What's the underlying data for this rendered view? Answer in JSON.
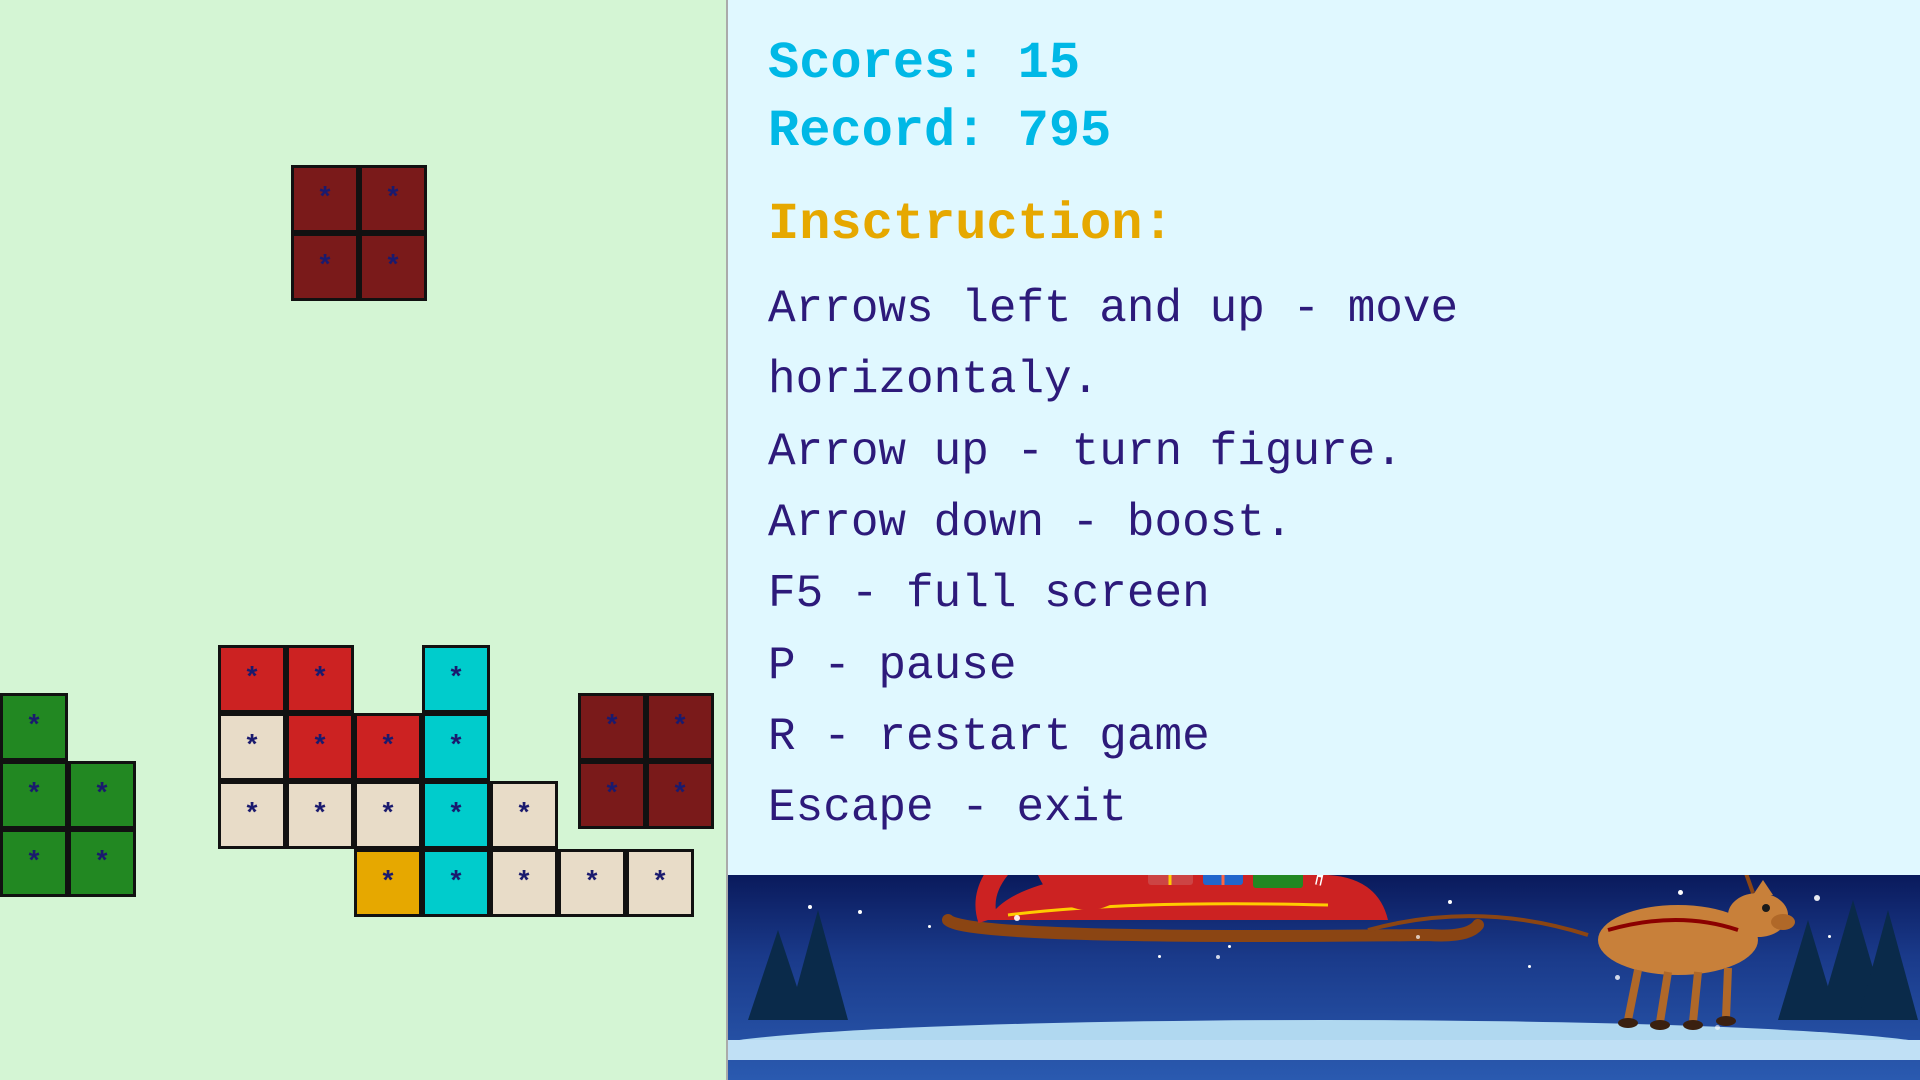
{
  "scores": {
    "label": "Scores: 15",
    "record_label": "Record: 795"
  },
  "instruction": {
    "title": "Insctruction:",
    "lines": [
      "Arrows left and up - move",
      "horizontaly.",
      "Arrow up - turn figure.",
      "Arrow down - boost.",
      "F5 - full screen",
      "P - pause",
      "R - restart game",
      "Escape - exit"
    ]
  },
  "board": {
    "bg_color": "#d4f5d4"
  },
  "colors": {
    "score": "#00b8e6",
    "instruction_title": "#e6a800",
    "instruction_body": "#2d1a7a",
    "info_bg": "#e0f8ff",
    "scene_bg": "#1a3a8a"
  }
}
